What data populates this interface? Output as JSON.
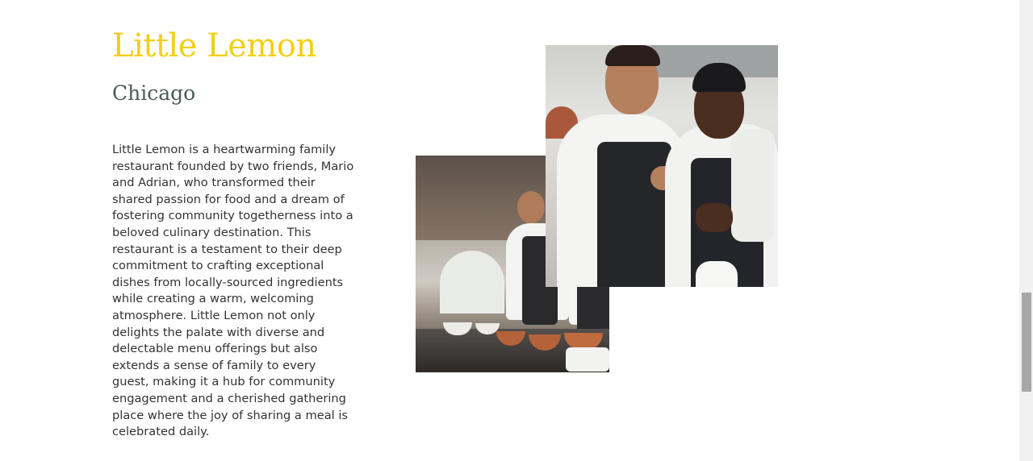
{
  "hero": {
    "title": "Little Lemon",
    "subtitle": "Chicago",
    "description": "Little Lemon is a heartwarming family restaurant founded by two friends, Mario and Adrian, who transformed their shared passion for food and a dream of fostering community togetherness into a beloved culinary destination. This restaurant is a testament to their deep commitment to crafting exceptional dishes from locally-sourced ingredients while creating a warm, welcoming atmosphere. Little Lemon not only delights the palate with diverse and delectable menu offerings but also extends a sense of family to every guest, making it a hub for community engagement and a cherished gathering place where the joy of sharing a meal is celebrated daily."
  },
  "colors": {
    "title": "#f2cf17",
    "subtitle": "#4a5d55",
    "body_text": "#333333",
    "background": "#ffffff"
  }
}
